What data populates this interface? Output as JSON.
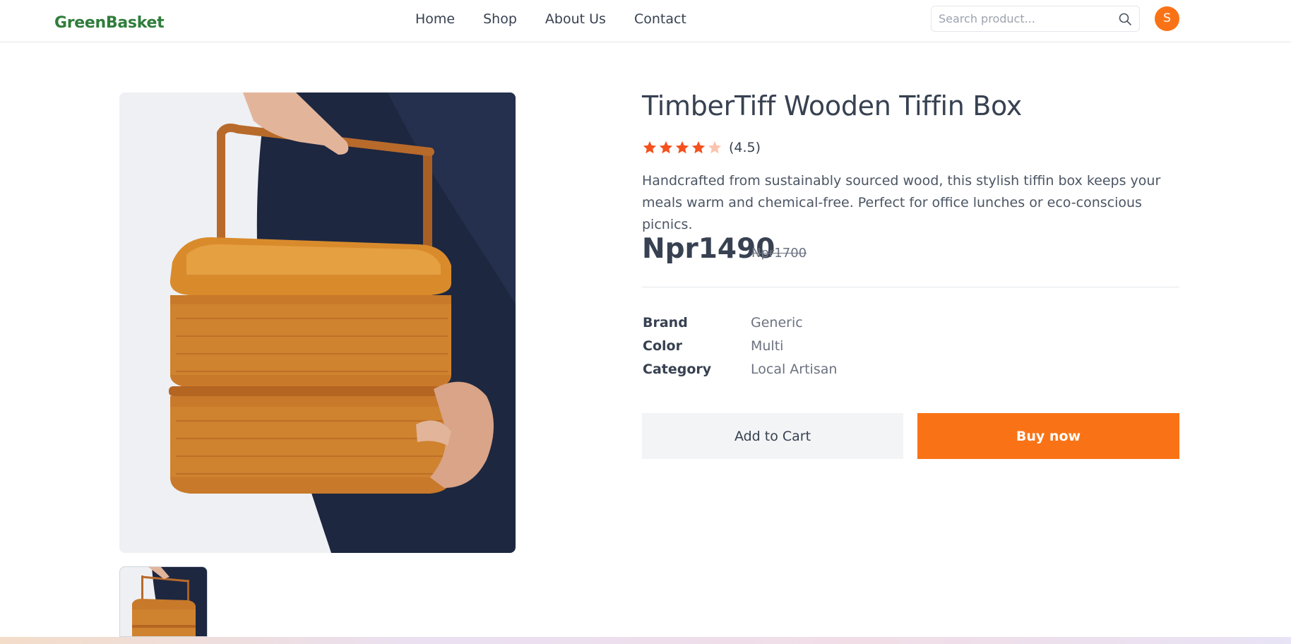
{
  "brand": "GreenBasket",
  "nav": {
    "links": [
      "Home",
      "Shop",
      "About Us",
      "Contact"
    ]
  },
  "search": {
    "placeholder": "Search product...",
    "icon": "search-icon"
  },
  "user": {
    "avatar_initial": "S",
    "avatar_color": "#f97316"
  },
  "product": {
    "title": "TimberTiff Wooden Tiffin Box",
    "rating_value": 4.5,
    "rating_text": "(4.5)",
    "description": "Handcrafted from sustainably sourced wood, this stylish tiffin box keeps your meals warm and chemical-free. Perfect for office lunches or eco-conscious picnics.",
    "price": "Npr1490",
    "old_price": "Npr1700",
    "specs": [
      {
        "key": "Brand",
        "value": "Generic"
      },
      {
        "key": "Color",
        "value": "Multi"
      },
      {
        "key": "Category",
        "value": "Local Artisan"
      }
    ]
  },
  "actions": {
    "add_to_cart": "Add to Cart",
    "buy_now": "Buy now"
  },
  "colors": {
    "brand_green": "#2f7d3b",
    "accent_orange": "#f97316",
    "star_color": "#f4511e"
  }
}
